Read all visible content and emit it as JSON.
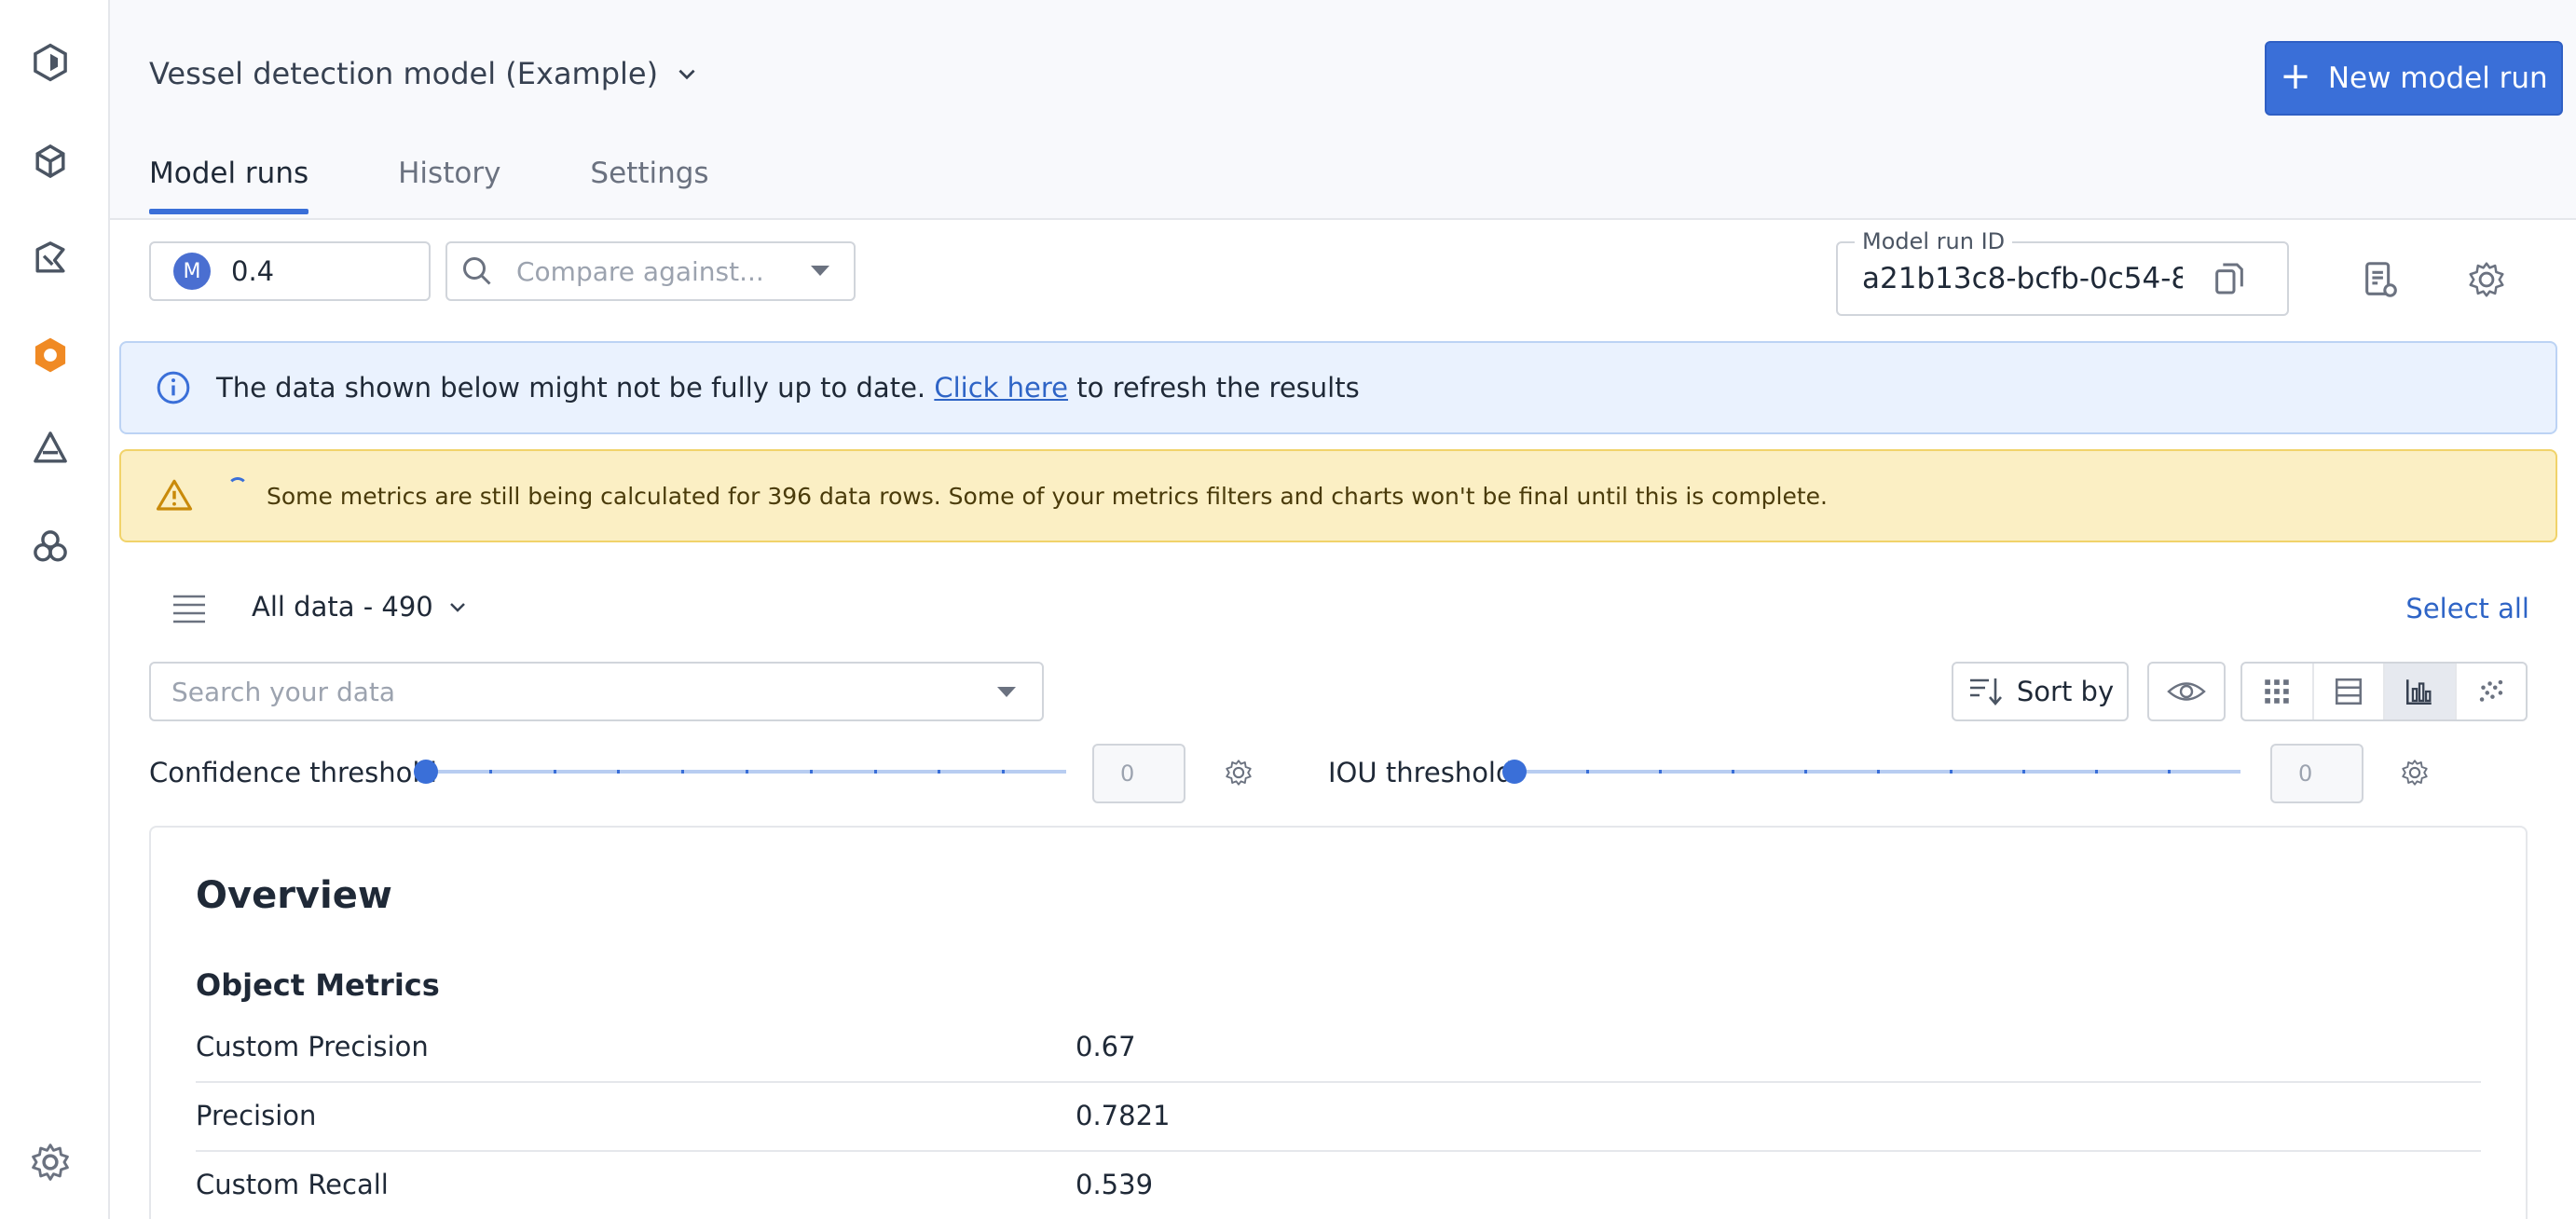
{
  "header": {
    "project_title": "Vessel detection model (Example)",
    "new_run_label": "New model run",
    "tabs": [
      {
        "label": "Model runs",
        "active": true
      },
      {
        "label": "History",
        "active": false
      },
      {
        "label": "Settings",
        "active": false
      }
    ]
  },
  "toolbar": {
    "model_badge": "M",
    "model_version": "0.4",
    "compare_placeholder": "Compare against...",
    "run_id_label": "Model run ID",
    "run_id_value": "a21b13c8-bcfb-0c54-8"
  },
  "info_banner": {
    "text_before": "The data shown below might not be fully up to date.",
    "link_text": "Click here",
    "text_after": "to refresh the results"
  },
  "warning_banner": {
    "text": "Some metrics are still being calculated for 396 data rows. Some of your metrics filters and charts won't be final until this is complete."
  },
  "data": {
    "selection_label": "All data - 490",
    "select_all_label": "Select all",
    "search_placeholder": "Search your data",
    "sort_label": "Sort by",
    "active_view": "charts"
  },
  "thresholds": {
    "confidence": {
      "label": "Confidence threshold",
      "value": "0"
    },
    "iou": {
      "label": "IOU threshold",
      "value": "0"
    }
  },
  "overview": {
    "title": "Overview",
    "section": "Object Metrics",
    "metrics": [
      {
        "name": "Custom Precision",
        "value": "0.67"
      },
      {
        "name": "Precision",
        "value": "0.7821"
      },
      {
        "name": "Custom Recall",
        "value": "0.539"
      }
    ]
  },
  "colors": {
    "accent": "#3a6fd8",
    "brand_active": "#f08a24",
    "info_bg": "#eaf2fe",
    "warning_bg": "#fbefc4"
  }
}
